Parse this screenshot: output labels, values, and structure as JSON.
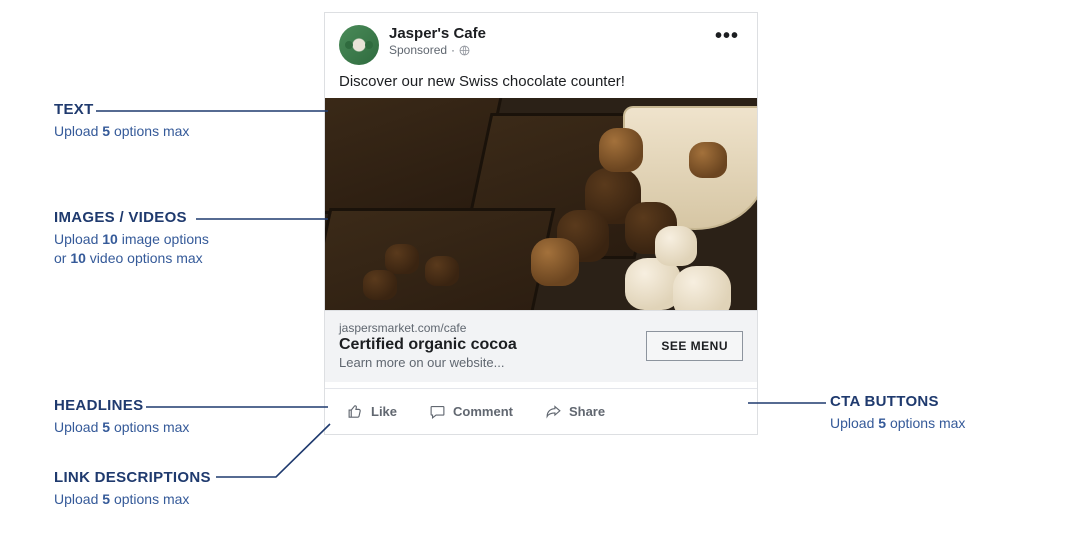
{
  "post": {
    "page_name": "Jasper's Cafe",
    "sponsored_label": "Sponsored",
    "body_text": "Discover our new Swiss chocolate counter!",
    "link_domain": "jaspersmarket.com/cafe",
    "headline": "Certified organic cocoa",
    "link_description": "Learn more on our website...",
    "cta_label": "SEE MENU",
    "actions": {
      "like": "Like",
      "comment": "Comment",
      "share": "Share"
    }
  },
  "callouts": {
    "text": {
      "title": "TEXT",
      "sub_pre": "Upload ",
      "sub_bold": "5",
      "sub_post": " options max"
    },
    "images": {
      "title": "IMAGES / VIDEOS",
      "sub_pre": "Upload ",
      "sub_bold": "10",
      "sub_mid": " image options\nor ",
      "sub_bold2": "10",
      "sub_post": " video options max"
    },
    "headlines": {
      "title": "HEADLINES",
      "sub_pre": "Upload ",
      "sub_bold": "5",
      "sub_post": " options max"
    },
    "linkdesc": {
      "title": "LINK DESCRIPTIONS",
      "sub_pre": "Upload ",
      "sub_bold": "5",
      "sub_post": " options max"
    },
    "cta": {
      "title": "CTA BUTTONS",
      "sub_pre": "Upload ",
      "sub_bold": "5",
      "sub_post": " options max"
    }
  }
}
